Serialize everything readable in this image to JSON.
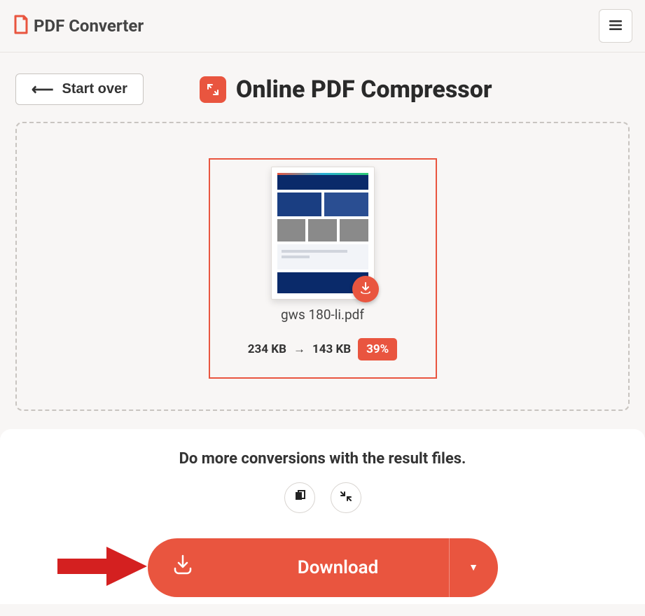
{
  "header": {
    "brand": "PDF Converter"
  },
  "toolbar": {
    "start_over": "Start over"
  },
  "page": {
    "title": "Online PDF Compressor"
  },
  "file": {
    "name": "gws 180-li.pdf",
    "size_before": "234 KB",
    "arrow": "→",
    "size_after": "143 KB",
    "reduction": "39%"
  },
  "actions": {
    "more_text": "Do more conversions with the result files.",
    "download_label": "Download"
  }
}
